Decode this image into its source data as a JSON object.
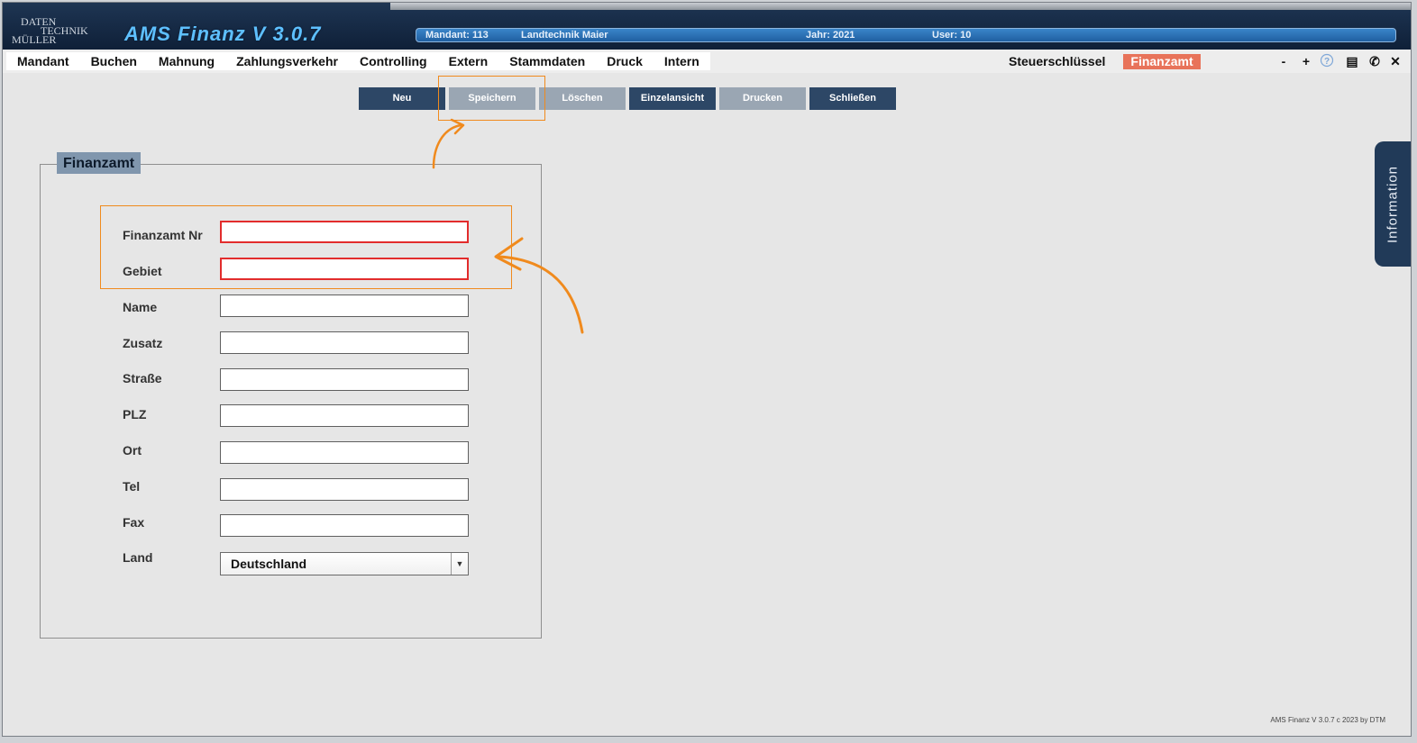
{
  "app": {
    "logo_lines": [
      "DATEN",
      "TECHNIK",
      "MÜLLER"
    ],
    "title": "AMS Finanz V 3.0.7"
  },
  "infobar": {
    "mandant": "Mandant:  113",
    "company": "Landtechnik Maier",
    "jahr": "Jahr:  2021",
    "user": "User:  10"
  },
  "menu": {
    "items": [
      "Mandant",
      "Buchen",
      "Mahnung",
      "Zahlungsverkehr",
      "Controlling",
      "Extern",
      "Stammdaten",
      "Druck",
      "Intern"
    ],
    "right": [
      "Steuerschlüssel",
      "Finanzamt"
    ],
    "controls": [
      "-",
      "+",
      "?",
      "▤",
      "✆",
      "✕"
    ]
  },
  "toolbar": {
    "buttons": [
      "Neu",
      "Speichern",
      "Löschen",
      "Einzelansicht",
      "Drucken",
      "Schließen"
    ]
  },
  "form": {
    "title": "Finanzamt",
    "labels": {
      "finanzamt_nr": "Finanzamt Nr",
      "gebiet": "Gebiet",
      "name": "Name",
      "zusatz": "Zusatz",
      "strasse": "Straße",
      "plz": "PLZ",
      "ort": "Ort",
      "tel": "Tel",
      "fax": "Fax",
      "land": "Land"
    },
    "values": {
      "finanzamt_nr": "",
      "gebiet": "",
      "name": "",
      "zusatz": "",
      "strasse": "",
      "plz": "",
      "ort": "",
      "tel": "",
      "fax": "",
      "land": "Deutschland"
    }
  },
  "side_tab": "Information",
  "footer": "AMS Finanz V 3.0.7 c  2023 by DTM",
  "colors": {
    "accent_orange": "#f08a1d",
    "active_tab": "#e8735a",
    "required_border": "#e22c2c",
    "dark_button": "#2d4766",
    "light_button": "#9aa6b3"
  }
}
